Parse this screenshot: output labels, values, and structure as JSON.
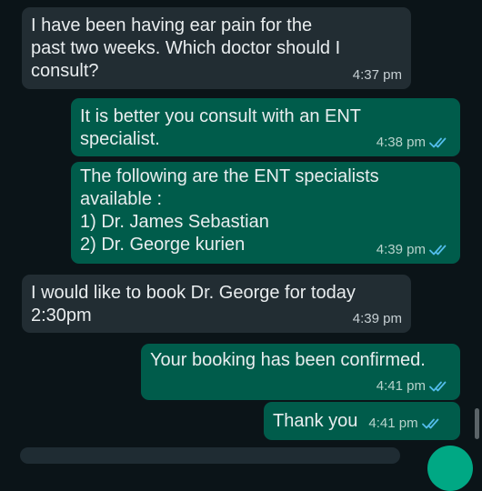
{
  "messages": [
    {
      "direction": "incoming",
      "text": "I have been having ear pain for the\npast two weeks. Which doctor should I\nconsult?",
      "time": "4:37 pm"
    },
    {
      "direction": "outgoing",
      "text": "It is better you consult with an ENT\nspecialist.",
      "time": "4:38 pm",
      "status": "read-double-tick-icon"
    },
    {
      "direction": "outgoing",
      "text": "The following are the ENT specialists\navailable :\n1) Dr. James Sebastian\n2) Dr. George kurien",
      "time": "4:39 pm",
      "status": "read-double-tick-icon"
    },
    {
      "direction": "incoming",
      "text": "I would like to book Dr. George for today\n2:30pm",
      "time": "4:39 pm"
    },
    {
      "direction": "outgoing",
      "text": "Your booking has been confirmed.",
      "time": "4:41 pm",
      "status": "read-double-tick-icon"
    },
    {
      "direction": "outgoing",
      "text": "Thank you",
      "time": "4:41 pm",
      "status": "read-double-tick-icon"
    }
  ],
  "colors": {
    "background": "#0b1418",
    "incoming_bubble": "#222d33",
    "outgoing_bubble": "#005c4b",
    "read_tick": "#53bdeb",
    "fab": "#00a884"
  }
}
